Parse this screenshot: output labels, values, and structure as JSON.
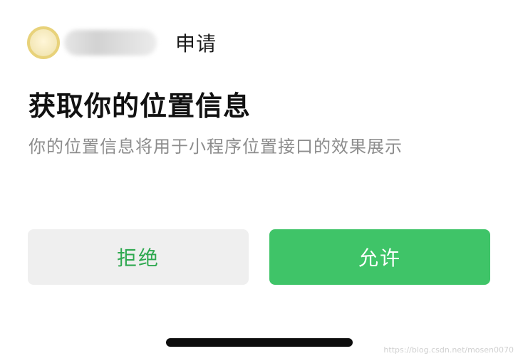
{
  "header": {
    "request_label": "申请"
  },
  "dialog": {
    "title": "获取你的位置信息",
    "description": "你的位置信息将用于小程序位置接口的效果展示"
  },
  "buttons": {
    "deny_label": "拒绝",
    "allow_label": "允许"
  },
  "watermark": "https://blog.csdn.net/mosen0070",
  "colors": {
    "accent_green": "#3fc468",
    "deny_text_green": "#2ea84f",
    "deny_background": "#efefef"
  }
}
